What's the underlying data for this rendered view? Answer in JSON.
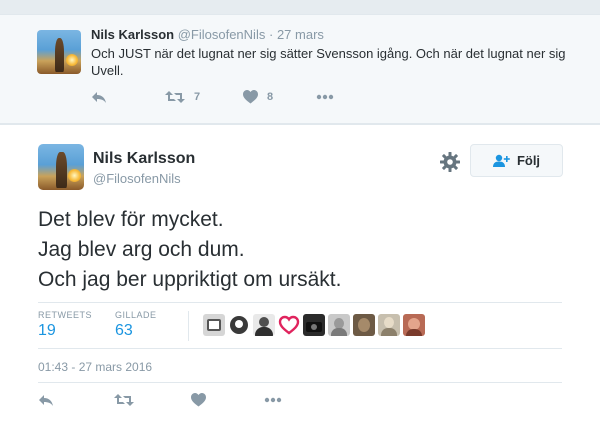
{
  "reply_tweet": {
    "name": "Nils Karlsson",
    "handle": "@FilosofenNils",
    "separator": "·",
    "date": "27 mars",
    "text": "Och JUST när det lugnat ner sig sätter Svensson igång. Och när det lugnat ner sig Uvell.",
    "retweet_count": "7",
    "like_count": "8"
  },
  "main_tweet": {
    "name": "Nils Karlsson",
    "handle": "@FilosofenNils",
    "follow_label": "Följ",
    "lines": [
      "Det blev för mycket.",
      "Jag blev arg och dum.",
      "Och jag ber uppriktigt om ursäkt."
    ],
    "retweets_label": "RETWEETS",
    "retweets_value": "19",
    "likes_label": "GILLADE",
    "likes_value": "63",
    "timestamp": "01:43 - 27 mars 2016"
  },
  "likers": [
    {
      "icon": "liker-avatar-1",
      "color": "#d6d6d6"
    },
    {
      "icon": "liker-avatar-2",
      "color": "#3a3a3a"
    },
    {
      "icon": "liker-avatar-3",
      "color": "#4f4f4f"
    },
    {
      "icon": "liker-avatar-heart",
      "color": "#e0245e"
    },
    {
      "icon": "liker-avatar-5",
      "color": "#2b2b2b"
    },
    {
      "icon": "liker-avatar-6",
      "color": "#9a9a9a"
    },
    {
      "icon": "liker-avatar-7",
      "color": "#6d5a45"
    },
    {
      "icon": "liker-avatar-8",
      "color": "#c7bfae"
    },
    {
      "icon": "liker-avatar-9",
      "color": "#b86a55"
    }
  ],
  "colors": {
    "accent": "#1b95e0",
    "muted": "#8899a6",
    "text": "#292f33",
    "background": "#e6ecf0"
  }
}
